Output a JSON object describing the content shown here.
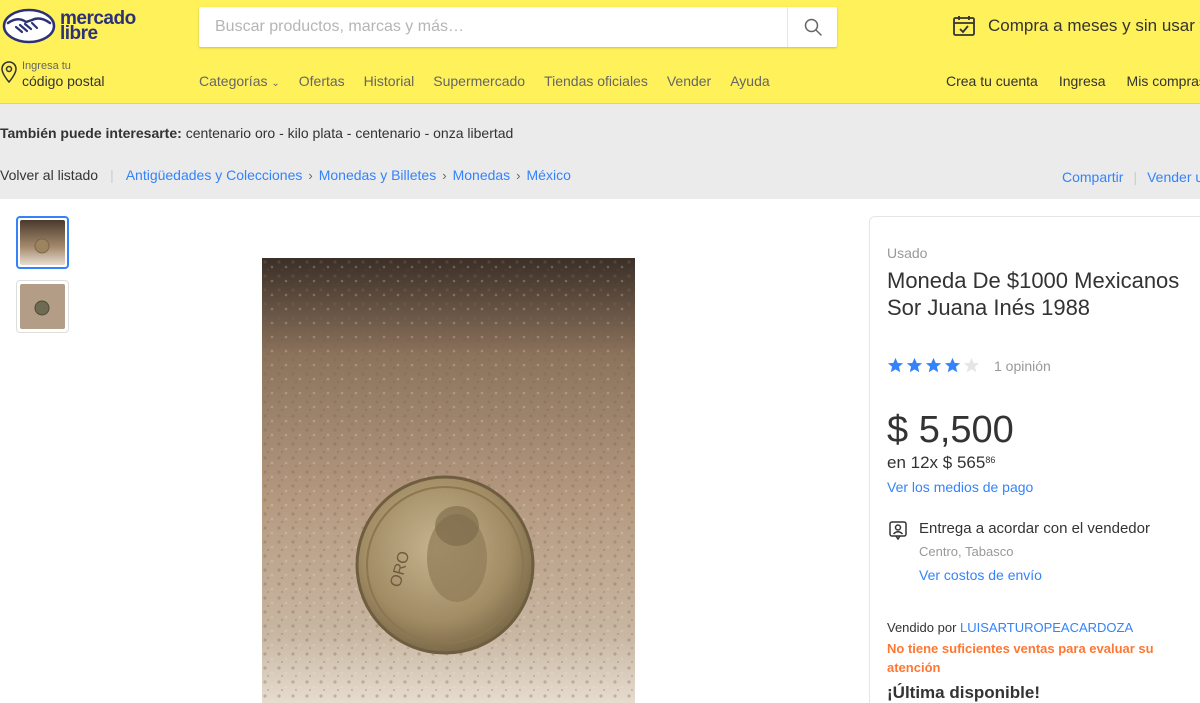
{
  "header": {
    "logo_line1": "mercado",
    "logo_line2": "libre",
    "search_placeholder": "Buscar productos, marcas y más…",
    "promo": "Compra a meses y sin usar tarjeta",
    "postal_small": "Ingresa tu",
    "postal_big": "código postal",
    "nav": [
      "Categorías",
      "Ofertas",
      "Historial",
      "Supermercado",
      "Tiendas oficiales",
      "Vender",
      "Ayuda"
    ],
    "account": [
      "Crea tu cuenta",
      "Ingresa",
      "Mis compras"
    ]
  },
  "suggest": {
    "label": "También puede interesarte:",
    "terms": "centenario oro - kilo plata - centenario - onza libertad"
  },
  "breadcrumb": {
    "back": "Volver al listado",
    "items": [
      "Antigüedades y Colecciones",
      "Monedas y Billetes",
      "Monedas",
      "México"
    ],
    "share": "Compartir",
    "sell": "Vender uno igual"
  },
  "product": {
    "condition": "Usado",
    "title": "Moneda De $1000 Mexicanos Sor Juana Inés 1988",
    "rating": 4,
    "reviews": "1 opinión",
    "price": "$ 5,500",
    "installments_prefix": "en 12x $ 565",
    "installments_cents": "86",
    "payment_link": "Ver los medios de pago",
    "delivery": "Entrega a acordar con el vendedor",
    "location": "Centro, Tabasco",
    "shipping_link": "Ver costos de envío",
    "seller_prefix": "Vendido por",
    "seller_name": "LUISARTUROPEACARDOZA",
    "seller_warning": "No tiene suficientes ventas para evaluar su atención",
    "stock": "¡Última disponible!"
  },
  "colors": {
    "header_yellow": "#fff159",
    "link_blue": "#3483fa",
    "star_blue": "#3483fa",
    "warning_orange": "#ff7733"
  }
}
